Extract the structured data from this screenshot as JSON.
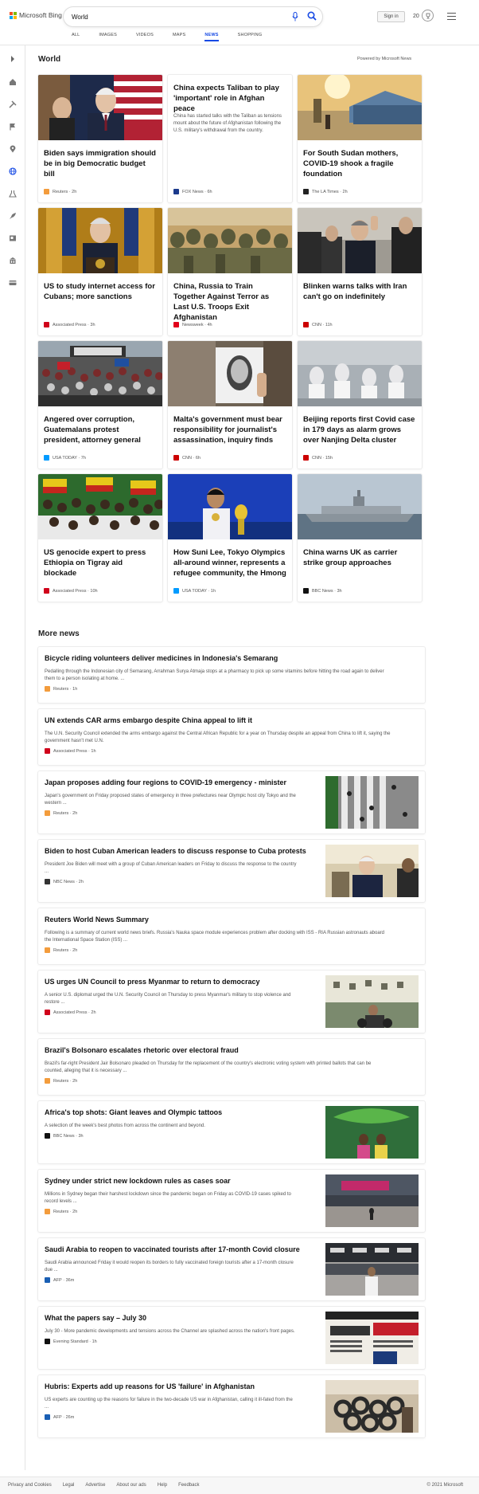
{
  "header": {
    "brand": "Microsoft Bing",
    "search_value": "World",
    "signin_label": "Sign in",
    "rewards_count": "20",
    "logo_colors": [
      "#f25022",
      "#7fba00",
      "#00a4ef",
      "#ffb900"
    ],
    "accent": "#174ae4"
  },
  "tabs": [
    {
      "label": "ALL",
      "active": false
    },
    {
      "label": "IMAGES",
      "active": false
    },
    {
      "label": "VIDEOS",
      "active": false
    },
    {
      "label": "MAPS",
      "active": false
    },
    {
      "label": "NEWS",
      "active": true
    },
    {
      "label": "SHOPPING",
      "active": false
    }
  ],
  "rail": {
    "icons": [
      "chevron-right-icon",
      "home-icon",
      "tools-icon",
      "flag-icon",
      "location-pin-icon",
      "globe-icon",
      "science-icon",
      "rocket-icon",
      "entertainment-icon",
      "bank-icon",
      "card-icon"
    ]
  },
  "world": {
    "title": "World",
    "powered_by": "Powered by Microsoft News",
    "cards": [
      {
        "title": "Biden says immigration should be in big Democratic budget bill",
        "source": "Reuters",
        "time": "2h",
        "src_color": "#f39c3c",
        "img": "biden-flags"
      },
      {
        "title": "China expects Taliban to play 'important' role in Afghan peace",
        "snippet": "China has started talks with the Taliban as tensions mount about the future of Afghanistan following the U.S. military's withdrawal from the country.",
        "source": "FOX News",
        "time": "6h",
        "src_color": "#1b3a8c",
        "img": ""
      },
      {
        "title": "For South Sudan mothers, COVID-19 shook a fragile foundation",
        "source": "The LA Times",
        "time": "2h",
        "src_color": "#222222",
        "img": "south-sudan"
      },
      {
        "title": "US to study internet access for Cubans; more sanctions",
        "source": "Associated Press",
        "time": "3h",
        "src_color": "#d0021b",
        "img": "biden-gold"
      },
      {
        "title": "China, Russia to Train Together Against Terror as Last U.S. Troops Exit Afghanistan",
        "source": "Newsweek",
        "time": "4h",
        "src_color": "#e2001a",
        "img": "troops"
      },
      {
        "title": "Blinken warns talks with Iran can't go on indefinitely",
        "source": "CNN",
        "time": "11h",
        "src_color": "#cc0000",
        "img": "blinken"
      },
      {
        "title": "Angered over corruption, Guatemalans protest president, attorney general",
        "source": "USA TODAY",
        "time": "7h",
        "src_color": "#009bff",
        "img": "protest"
      },
      {
        "title": "Malta's government must bear responsibility for journalist's assassination, inquiry finds",
        "source": "CNN",
        "time": "6h",
        "src_color": "#cc0000",
        "img": "malta"
      },
      {
        "title": "Beijing reports first Covid case in 179 days as alarm grows over Nanjing Delta cluster",
        "source": "CNN",
        "time": "15h",
        "src_color": "#cc0000",
        "img": "hazmat"
      },
      {
        "title": "US genocide expert to press Ethiopia on Tigray aid blockade",
        "source": "Associated Press",
        "time": "10h",
        "src_color": "#d0021b",
        "img": "ethiopia"
      },
      {
        "title": "How Suni Lee, Tokyo Olympics all-around winner, represents a refugee community, the Hmong",
        "source": "USA TODAY",
        "time": "1h",
        "src_color": "#009bff",
        "img": "suni"
      },
      {
        "title": "China warns UK as carrier strike group approaches",
        "source": "BBC News",
        "time": "3h",
        "src_color": "#111111",
        "img": "carrier"
      }
    ]
  },
  "more_news": {
    "title": "More news",
    "items": [
      {
        "title": "Bicycle riding volunteers deliver medicines in Indonesia's Semarang",
        "snippet": [
          "Pedalling through the Indonesian city of Semarang, Arrahman Surya Atmaja stops at a pharmacy to pick up some vitamins before hitting the road again to deliver",
          "them to a person isolating at home. ..."
        ],
        "source": "Reuters",
        "time": "1h",
        "src_color": "#f39c3c",
        "thumb": ""
      },
      {
        "title": "UN extends CAR arms embargo despite China appeal to lift it",
        "snippet": [
          "The U.N. Security Council extended the arms embargo against the Central African Republic for a year on Thursday despite an appeal from China to lift it, saying the",
          "government hasn't met U.N."
        ],
        "source": "Associated Press",
        "time": "1h",
        "src_color": "#d0021b",
        "thumb": ""
      },
      {
        "title": "Japan proposes adding four regions to COVID-19 emergency - minister",
        "snippet": [
          "Japan's government on Friday proposed states of emergency in three prefectures near Olympic host city Tokyo and the",
          "western ..."
        ],
        "source": "Reuters",
        "time": "2h",
        "src_color": "#f39c3c",
        "thumb": "crosswalk"
      },
      {
        "title": "Biden to host Cuban American leaders to discuss response to Cuba protests",
        "snippet": [
          "President Joe Biden will meet with a group of Cuban American leaders on Friday to discuss the response to the country",
          "..."
        ],
        "source": "NBC News",
        "time": "2h",
        "src_color": "#333333",
        "thumb": "biden-office"
      },
      {
        "title": "Reuters World News Summary",
        "snippet": [
          "Following is a summary of current world news briefs. Russia's Nauka space module experiences problem after docking with ISS - RIA Russian astronauts aboard",
          "the International Space Station (ISS) ..."
        ],
        "source": "Reuters",
        "time": "2h",
        "src_color": "#f39c3c",
        "thumb": ""
      },
      {
        "title": "US urges UN Council to press Myanmar to return to democracy",
        "snippet": [
          "A senior U.S. diplomat urged the U.N. Security Council on Thursday to press Myanmar's military to stop violence and",
          "restore ..."
        ],
        "source": "Associated Press",
        "time": "2h",
        "src_color": "#d0021b",
        "thumb": "myanmar"
      },
      {
        "title": "Brazil's Bolsonaro escalates rhetoric over electoral fraud",
        "snippet": [
          "Brazil's far-right President Jair Bolsonaro pleaded on Thursday for the replacement of the country's electronic voting system with printed ballots that can be",
          "counted, alleging that it is necessary ..."
        ],
        "source": "Reuters",
        "time": "2h",
        "src_color": "#f39c3c",
        "thumb": ""
      },
      {
        "title": "Africa's top shots: Giant leaves and Olympic tattoos",
        "snippet": [
          "A selection of the week's best photos from across the continent and beyond."
        ],
        "source": "BBC News",
        "time": "3h",
        "src_color": "#111111",
        "thumb": "leaves"
      },
      {
        "title": "Sydney under strict new lockdown rules as cases soar",
        "snippet": [
          "Millions in Sydney began their harshest lockdown since the pandemic began on Friday as COVID-19 cases spiked to",
          "record levels ..."
        ],
        "source": "Reuters",
        "time": "2h",
        "src_color": "#f39c3c",
        "thumb": "sydney"
      },
      {
        "title": "Saudi Arabia to reopen to vaccinated tourists after 17-month Covid closure",
        "snippet": [
          "Saudi Arabia announced Friday it would reopen its borders to fully vaccinated foreign tourists after a 17-month closure",
          "due ..."
        ],
        "source": "AFP",
        "time": "36m",
        "src_color": "#1a5fb4",
        "thumb": "airport"
      },
      {
        "title": "What the papers say – July 30",
        "snippet": [
          "July 30 - More pandemic developments and tensions across the Channel are splashed across the nation's front pages."
        ],
        "source": "Evening Standard",
        "time": "1h",
        "src_color": "#111111",
        "thumb": "papers"
      },
      {
        "title": "Hubris: Experts add up reasons for US 'failure' in Afghanistan",
        "snippet": [
          "US experts are counting up the reasons for failure in the two-decade US war in Afghanistan, calling it ill-fated from the",
          "..."
        ],
        "source": "AFP",
        "time": "26m",
        "src_color": "#1a5fb4",
        "thumb": "tires"
      }
    ]
  },
  "footer": {
    "links": [
      "Privacy and Cookies",
      "Legal",
      "Advertise",
      "About our ads",
      "Help",
      "Feedback"
    ],
    "copyright": "© 2021 Microsoft"
  }
}
